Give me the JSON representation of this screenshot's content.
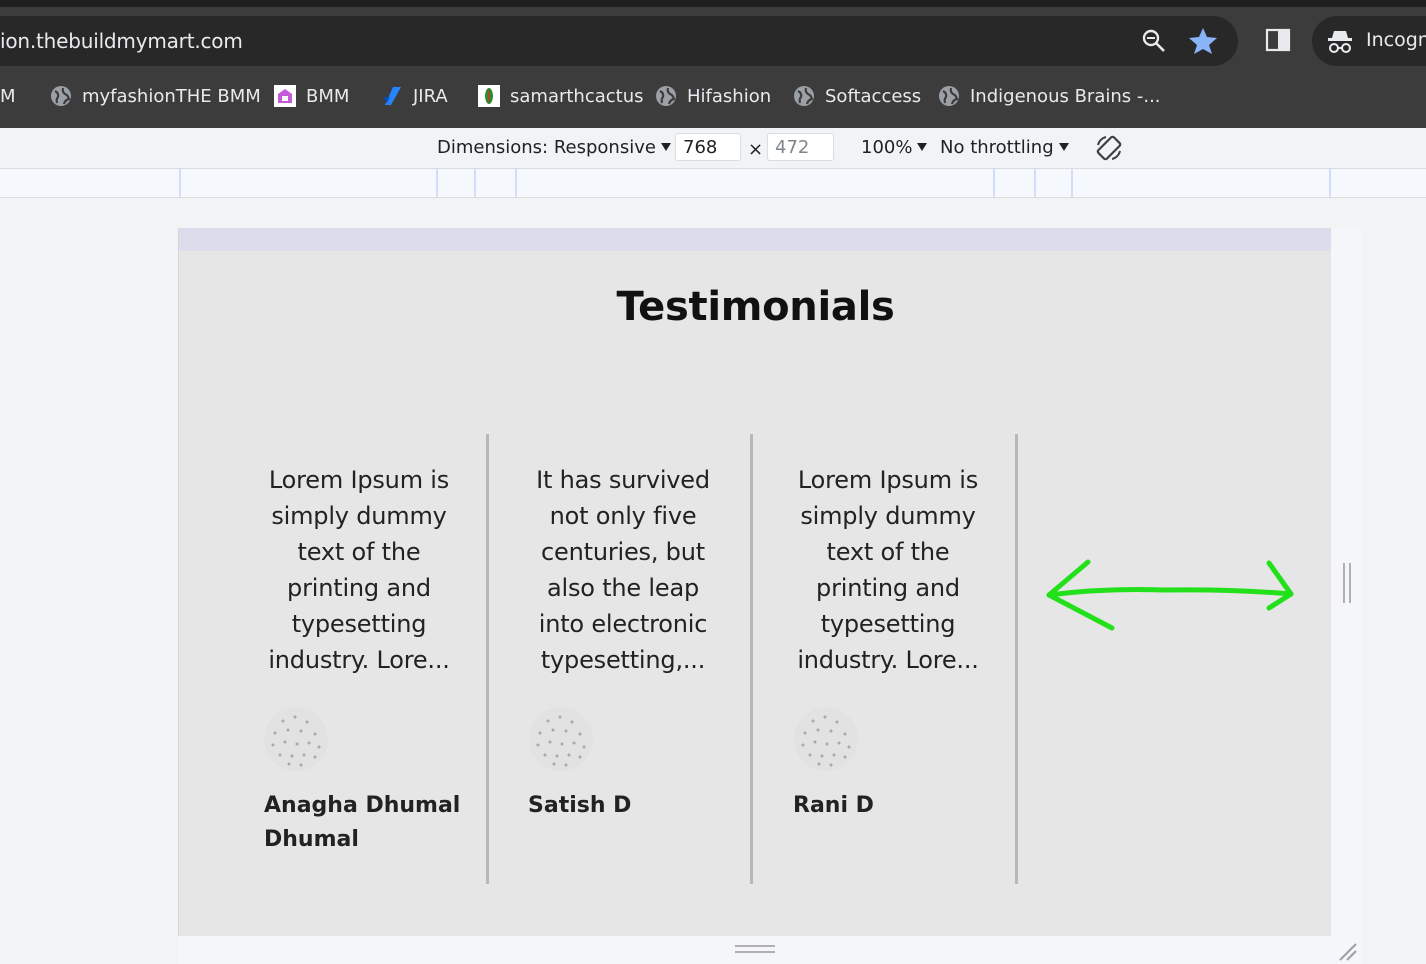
{
  "browser": {
    "url": "ion.thebuildmymart.com",
    "incognito_label": "Incogni",
    "icons": [
      "zoom-icon",
      "star-icon",
      "side-panel-icon",
      "incognito-icon"
    ],
    "bookmarks": [
      {
        "label": "M",
        "icon": "none"
      },
      {
        "label": "myfashionTHE BMM",
        "icon": "globe-icon"
      },
      {
        "label": "BMM",
        "icon": "bmm-logo-icon"
      },
      {
        "label": "JIRA",
        "icon": "jira-icon"
      },
      {
        "label": "samarthcactus",
        "icon": "cactus-icon"
      },
      {
        "label": "Hifashion",
        "icon": "globe-icon"
      },
      {
        "label": "Softaccess",
        "icon": "globe-icon"
      },
      {
        "label": "Indigenous Brains -...",
        "icon": "globe-icon"
      }
    ]
  },
  "devtools": {
    "dimensions_label": "Dimensions: Responsive",
    "width": "768",
    "times": "×",
    "height": "472",
    "zoom": "100%",
    "throttling": "No throttling"
  },
  "page": {
    "title": "Testimonials",
    "testimonials": [
      {
        "text": "Lorem Ipsum is simply dummy text of the printing and typesetting industry. Lore...",
        "name": "Anagha Dhumal Dhumal"
      },
      {
        "text": "It has survived not only five centuries, but also the leap into electronic typesetting,...",
        "name": "Satish D"
      },
      {
        "text": "Lorem Ipsum is simply dummy text of the printing and typesetting industry. Lore...",
        "name": "Rani D"
      }
    ],
    "annotation": "double-headed-arrow",
    "colors": {
      "annotation": "#22e01a",
      "card_bg": "#e6e6e6",
      "separator": "#b8b8b8"
    }
  }
}
